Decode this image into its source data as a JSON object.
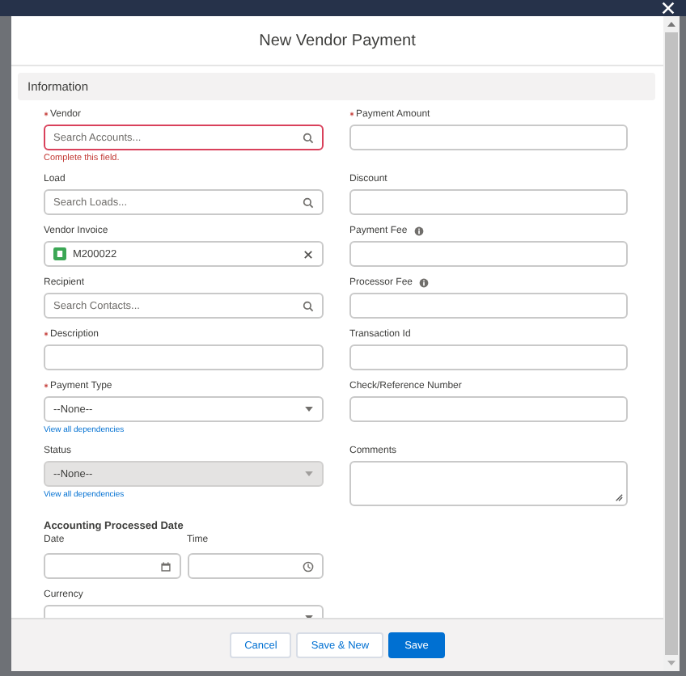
{
  "modal": {
    "title": "New Vendor Payment"
  },
  "section": {
    "title": "Information",
    "expanded": true
  },
  "rows": [
    {
      "left": {
        "kind": "lookup",
        "label": "Vendor",
        "required": true,
        "placeholder": "Search Accounts...",
        "error": "Complete this field."
      },
      "right": {
        "kind": "text",
        "label": "Payment Amount",
        "required": true
      }
    },
    {
      "left": {
        "kind": "lookup",
        "label": "Load",
        "required": false,
        "placeholder": "Search Loads..."
      },
      "right": {
        "kind": "text",
        "label": "Discount",
        "required": false
      }
    },
    {
      "left": {
        "kind": "pill",
        "label": "Vendor Invoice",
        "required": false,
        "value": "M200022"
      },
      "right": {
        "kind": "text",
        "label": "Payment Fee",
        "required": false,
        "info": true
      }
    },
    {
      "left": {
        "kind": "lookup",
        "label": "Recipient",
        "required": false,
        "placeholder": "Search Contacts..."
      },
      "right": {
        "kind": "text",
        "label": "Processor Fee",
        "required": false,
        "info": true
      }
    },
    {
      "left": {
        "kind": "text",
        "label": "Description",
        "required": true
      },
      "right": {
        "kind": "text",
        "label": "Transaction Id",
        "required": false
      }
    },
    {
      "left": {
        "kind": "select",
        "label": "Payment Type",
        "required": true,
        "value": "--None--",
        "disabled": false,
        "link": "View all dependencies"
      },
      "right": {
        "kind": "text",
        "label": "Check/Reference Number",
        "required": false
      }
    },
    {
      "left": {
        "kind": "select",
        "label": "Status",
        "required": false,
        "value": "--None--",
        "disabled": true,
        "link": "View all dependencies"
      },
      "right": {
        "kind": "textarea",
        "label": "Comments",
        "required": false
      }
    },
    {
      "left": {
        "kind": "datetime",
        "label": "Accounting Processed Date",
        "date_label": "Date",
        "time_label": "Time"
      }
    },
    {
      "left": {
        "kind": "select",
        "label": "Currency",
        "required": false,
        "disabled": false
      }
    }
  ],
  "buttons": [
    {
      "label": "Cancel",
      "kind": "neutral"
    },
    {
      "label": "Save & New",
      "kind": "neutral"
    },
    {
      "label": "Save",
      "kind": "brand"
    }
  ]
}
